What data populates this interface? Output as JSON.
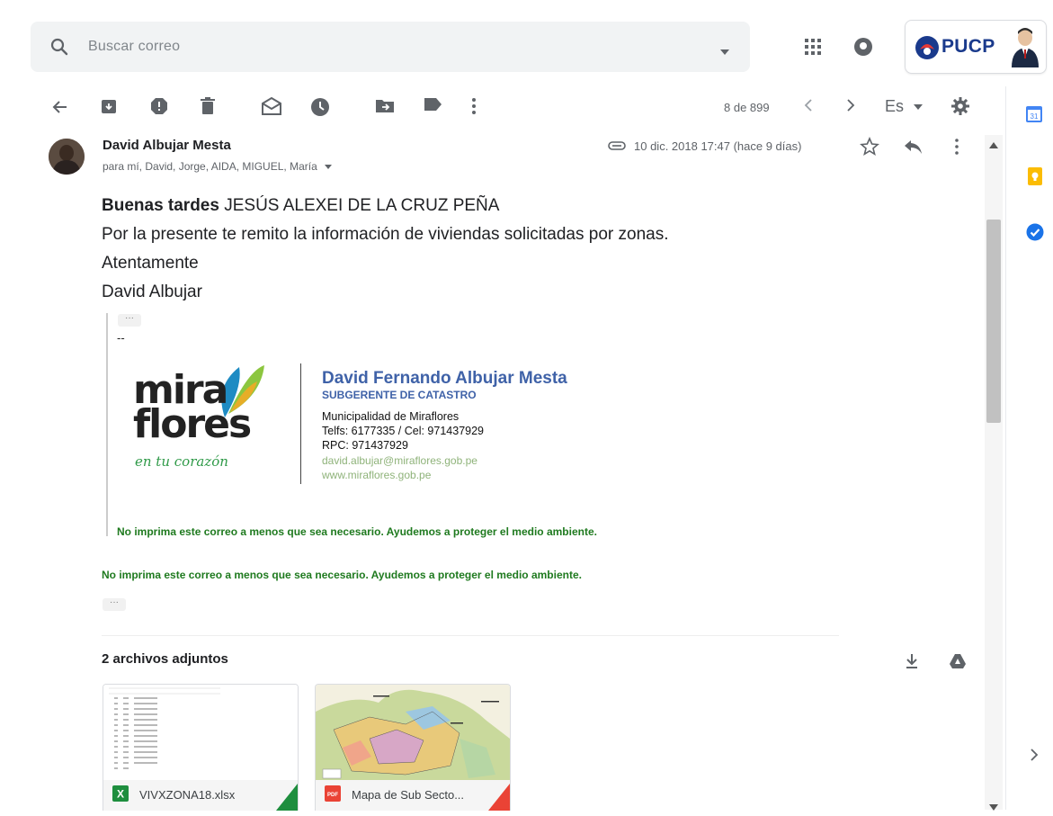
{
  "search": {
    "placeholder": "Buscar correo"
  },
  "account": {
    "org_label": "PUCP"
  },
  "toolbar": {
    "actions": [
      "back-icon",
      "archive-icon",
      "report-spam-icon",
      "delete-icon",
      "mark-unread-icon",
      "snooze-icon",
      "move-to-icon",
      "labels-icon",
      "more-icon"
    ],
    "count": "8 de 899",
    "language": "Es"
  },
  "message": {
    "sender": "David Albujar Mesta",
    "recipients": "para mí, David, Jorge, AIDA, MIGUEL, María",
    "date": "10 dic. 2018 17:47 (hace 9 días)",
    "body": {
      "greeting_bold": "Buenas tardes",
      "greeting_name": " JESÚS ALEXEI DE LA CRUZ PEÑA",
      "line2": "Por la presente te remito la información de viviendas solicitadas por zonas.",
      "line3": "Atentamente",
      "line4": "David Albujar"
    },
    "quoted_dash": "--",
    "signature": {
      "logo_line1": "mira",
      "logo_line2": "flores",
      "logo_tagline": "en tu corazón",
      "name": "David Fernando Albujar Mesta",
      "title": "SUBGERENTE DE CATASTRO",
      "org": "Municipalidad de Miraflores",
      "phones": "Telfs: 6177335 / Cel: 971437929",
      "rpc": "RPC: 971437929",
      "email": "david.albujar@miraflores.gob.pe",
      "web": "www.miraflores.gob.pe"
    },
    "eco_note": "No imprima este correo a menos que sea necesario. Ayudemos a proteger el medio ambiente."
  },
  "attachments": {
    "title": "2 archivos adjuntos",
    "items": [
      {
        "name": "VIVXZONA18.xlsx",
        "type": "xlsx",
        "icon_label": "X"
      },
      {
        "name": "Mapa de Sub Secto...",
        "type": "pdf",
        "icon_label": "PDF"
      }
    ]
  },
  "colors": {
    "sheets_green": "#1e8e3e",
    "pdf_red": "#ea4335",
    "signature_blue": "#3f62a8",
    "eco_green": "#1f7a1f"
  }
}
